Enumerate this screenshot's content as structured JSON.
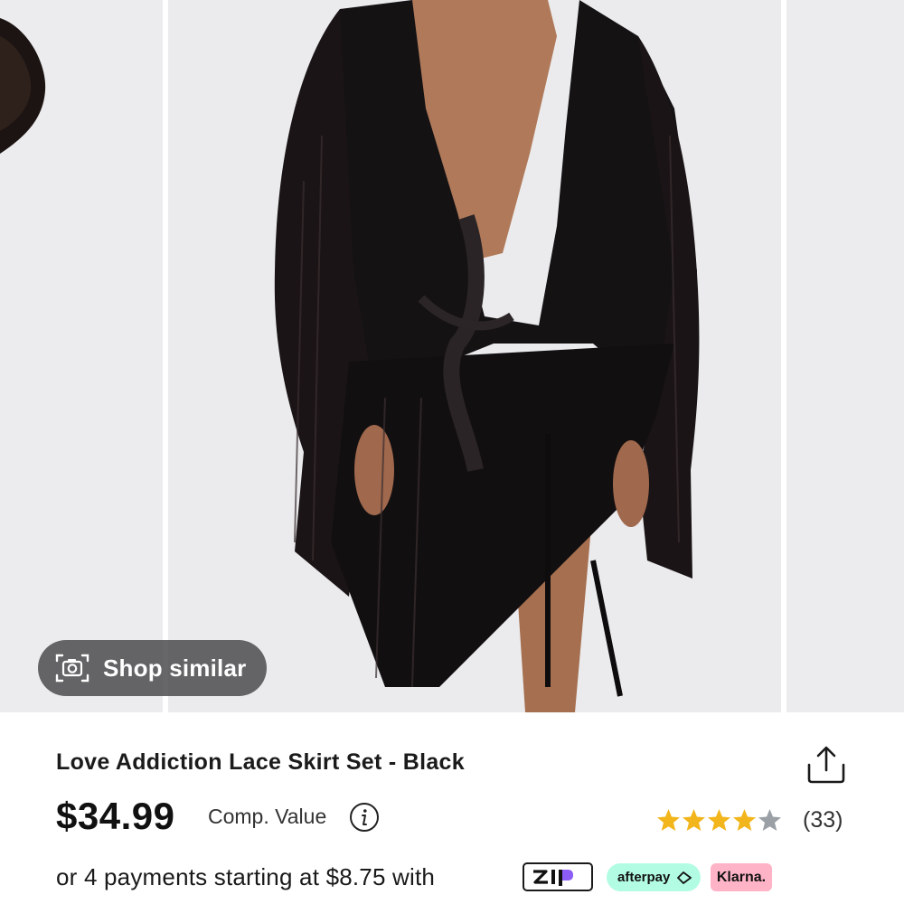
{
  "gallery": {
    "shop_similar_label": "Shop similar"
  },
  "product": {
    "title": "Love Addiction Lace Skirt Set - Black",
    "price": "$34.99",
    "comp_value_label": "Comp. Value",
    "rating": 4.5,
    "review_count": "(33)",
    "payments_text": "or 4 payments starting at $8.75 with"
  },
  "payment_providers": {
    "zip": "zip",
    "afterpay": "afterpay",
    "klarna": "Klarna."
  },
  "icons": {
    "camera": "camera-icon",
    "share": "share-icon",
    "info": "info-icon",
    "star": "star-icon"
  },
  "colors": {
    "star_filled": "#f2b51c",
    "star_empty": "#9aa0a6",
    "afterpay_bg": "#b2fce4",
    "klarna_bg": "#ffb3c7",
    "pill_bg": "#464648"
  }
}
